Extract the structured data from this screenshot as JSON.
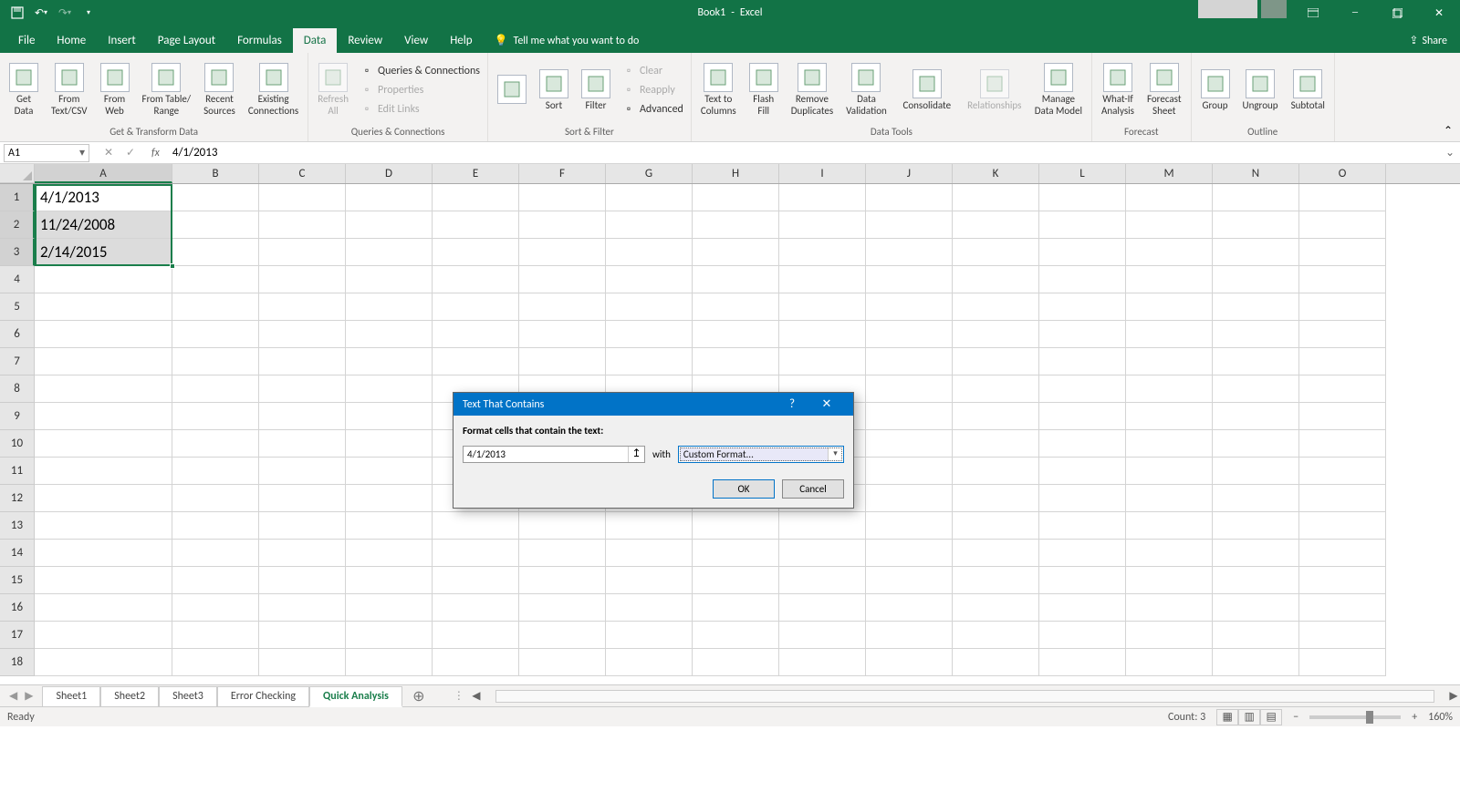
{
  "app": {
    "doc": "Book1",
    "name": "Excel"
  },
  "menu": {
    "tabs": [
      "File",
      "Home",
      "Insert",
      "Page Layout",
      "Formulas",
      "Data",
      "Review",
      "View",
      "Help"
    ],
    "active": "Data",
    "tellme": "Tell me what you want to do",
    "share": "Share"
  },
  "ribbon": {
    "groups": [
      {
        "label": "Get & Transform Data",
        "items": [
          {
            "t": "big",
            "label": "Get\nData"
          },
          {
            "t": "big",
            "label": "From\nText/CSV"
          },
          {
            "t": "big",
            "label": "From\nWeb"
          },
          {
            "t": "big",
            "label": "From Table/\nRange"
          },
          {
            "t": "big",
            "label": "Recent\nSources"
          },
          {
            "t": "big",
            "label": "Existing\nConnections"
          }
        ]
      },
      {
        "label": "Queries & Connections",
        "items": [
          {
            "t": "big",
            "label": "Refresh\nAll",
            "disabled": true
          },
          {
            "t": "small",
            "rows": [
              {
                "label": "Queries & Connections"
              },
              {
                "label": "Properties",
                "disabled": true
              },
              {
                "label": "Edit Links",
                "disabled": true
              }
            ]
          }
        ]
      },
      {
        "label": "Sort & Filter",
        "items": [
          {
            "t": "big",
            "label": "",
            "icon": "az"
          },
          {
            "t": "big",
            "label": "Sort"
          },
          {
            "t": "big",
            "label": "Filter"
          },
          {
            "t": "small",
            "rows": [
              {
                "label": "Clear",
                "disabled": true
              },
              {
                "label": "Reapply",
                "disabled": true
              },
              {
                "label": "Advanced"
              }
            ]
          }
        ]
      },
      {
        "label": "Data Tools",
        "items": [
          {
            "t": "big",
            "label": "Text to\nColumns"
          },
          {
            "t": "big",
            "label": "Flash\nFill"
          },
          {
            "t": "big",
            "label": "Remove\nDuplicates"
          },
          {
            "t": "big",
            "label": "Data\nValidation"
          },
          {
            "t": "big",
            "label": "Consolidate"
          },
          {
            "t": "big",
            "label": "Relationships",
            "disabled": true
          },
          {
            "t": "big",
            "label": "Manage\nData Model"
          }
        ]
      },
      {
        "label": "Forecast",
        "items": [
          {
            "t": "big",
            "label": "What-If\nAnalysis"
          },
          {
            "t": "big",
            "label": "Forecast\nSheet"
          }
        ]
      },
      {
        "label": "Outline",
        "items": [
          {
            "t": "big",
            "label": "Group"
          },
          {
            "t": "big",
            "label": "Ungroup"
          },
          {
            "t": "big",
            "label": "Subtotal"
          }
        ]
      }
    ]
  },
  "formula_bar": {
    "name_box": "A1",
    "formula": "4/1/2013"
  },
  "grid": {
    "columns": [
      "A",
      "B",
      "C",
      "D",
      "E",
      "F",
      "G",
      "H",
      "I",
      "J",
      "K",
      "L",
      "M",
      "N",
      "O"
    ],
    "rows": 18,
    "data": {
      "A1": "4/1/2013",
      "A2": "11/24/2008",
      "A3": "2/14/2015"
    },
    "selection": {
      "col": "A",
      "rows": [
        1,
        3
      ]
    }
  },
  "dialog": {
    "title": "Text That Contains",
    "prompt": "Format cells that contain the text:",
    "value": "4/1/2013",
    "with": "with",
    "format": "Custom Format...",
    "ok": "OK",
    "cancel": "Cancel"
  },
  "sheets": {
    "tabs": [
      "Sheet1",
      "Sheet2",
      "Sheet3",
      "Error Checking",
      "Quick Analysis"
    ],
    "active": "Quick Analysis"
  },
  "status": {
    "ready": "Ready",
    "count": "Count: 3",
    "zoom": "160%"
  }
}
